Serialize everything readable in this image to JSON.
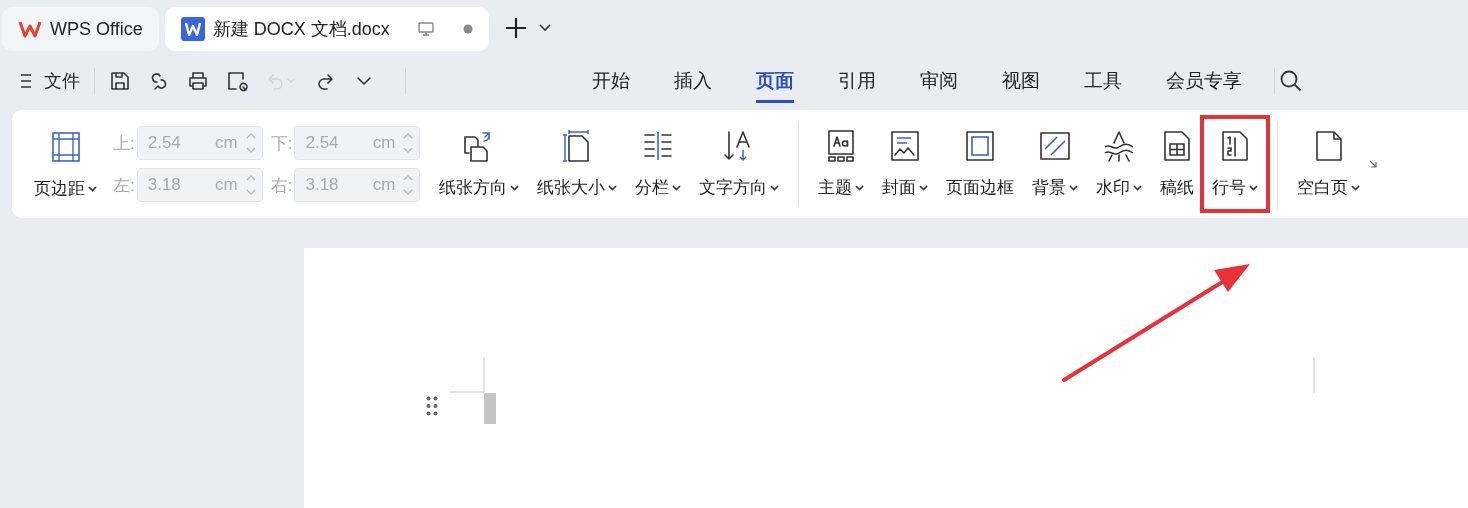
{
  "tabs": [
    {
      "kind": "home",
      "label": "WPS Office",
      "selected": false
    },
    {
      "kind": "doc",
      "label": "新建 DOCX 文档.docx",
      "selected": true
    }
  ],
  "toolbar": {
    "file_menu": "文件",
    "actions": [
      {
        "kind": "save",
        "disabled": false
      },
      {
        "kind": "link",
        "disabled": false
      },
      {
        "kind": "print",
        "disabled": false
      },
      {
        "kind": "preview",
        "disabled": false
      },
      {
        "kind": "undo",
        "disabled": true
      },
      {
        "kind": "redo",
        "disabled": false
      },
      {
        "kind": "more",
        "disabled": false
      }
    ]
  },
  "menu_tabs": [
    {
      "label": "开始",
      "selected": false
    },
    {
      "label": "插入",
      "selected": false
    },
    {
      "label": "页面",
      "selected": true
    },
    {
      "label": "引用",
      "selected": false
    },
    {
      "label": "审阅",
      "selected": false
    },
    {
      "label": "视图",
      "selected": false
    },
    {
      "label": "工具",
      "selected": false
    },
    {
      "label": "会员专享",
      "selected": false
    }
  ],
  "ribbon": {
    "margins": {
      "label": "页边距",
      "fields": [
        {
          "label": "上:",
          "value": "2.54",
          "unit": "cm",
          "disabled": true
        },
        {
          "label": "下:",
          "value": "2.54",
          "unit": "cm",
          "disabled": true
        },
        {
          "label": "左:",
          "value": "3.18",
          "unit": "cm",
          "disabled": true
        },
        {
          "label": "右:",
          "value": "3.18",
          "unit": "cm",
          "disabled": true
        }
      ]
    },
    "groups": [
      {
        "items": [
          {
            "label": "纸张方向",
            "dropdown": true,
            "highlighted": false
          },
          {
            "label": "纸张大小",
            "dropdown": true,
            "highlighted": false
          },
          {
            "label": "分栏",
            "dropdown": true,
            "highlighted": false
          },
          {
            "label": "文字方向",
            "dropdown": true,
            "highlighted": false
          }
        ]
      },
      {
        "items": [
          {
            "label": "主题",
            "dropdown": true,
            "highlighted": false
          },
          {
            "label": "封面",
            "dropdown": true,
            "highlighted": false
          },
          {
            "label": "页面边框",
            "dropdown": false,
            "highlighted": false
          },
          {
            "label": "背景",
            "dropdown": true,
            "highlighted": false
          },
          {
            "label": "水印",
            "dropdown": true,
            "highlighted": false
          },
          {
            "label": "稿纸",
            "dropdown": false,
            "highlighted": false
          },
          {
            "label": "行号",
            "dropdown": true,
            "highlighted": true
          }
        ]
      },
      {
        "items": [
          {
            "label": "空白页",
            "dropdown": true,
            "highlighted": false
          }
        ]
      }
    ]
  },
  "annotation_arrow": {
    "shown": true
  }
}
